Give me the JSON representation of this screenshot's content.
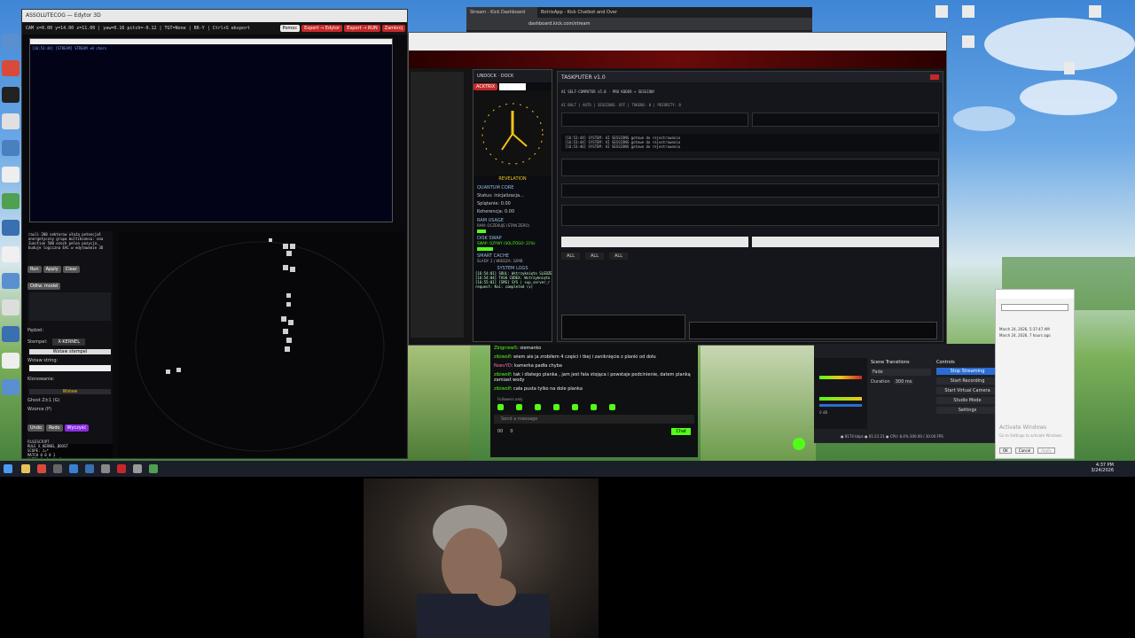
{
  "editor": {
    "title": "ASSOLUTECOG — Edytor 3D",
    "status_line": "CAM x=0.00 y=14.00 z=11.00 | yaw=0.16 pitch=-0.12 | TGT=None | BR-Y | Ctrl+S eksport",
    "buttons": [
      "Pomoc",
      "Export → Edytor",
      "Export → RUN",
      "Zamknij"
    ],
    "console_line": "[16:53:44] [STREAM] STREAM +0 chars",
    "left_text": "rauli 200 sektorow ułożą potencjał energetyczny grupa multiksonsu: ona Junction 500 ezoch pelna pozycja, buduje logiczna EAC w edytowanie 3D",
    "left_buttons": [
      "Run",
      "Apply",
      "Clear",
      "Odtw. model"
    ],
    "field_labels": [
      "Pędzel:",
      "Stempel:",
      "Wstaw string:",
      "Klonowanie:"
    ],
    "stamp_value": "X-KERNEL",
    "insert_stamp": "Wstaw stempel",
    "insert": "Wstaw",
    "checks": [
      "Ghost Z±1 (G)",
      "Wzorce (P)"
    ],
    "undo_buttons": [
      "Undo",
      "Redo",
      "Wyczyść"
    ],
    "rule_header": "RULESCRIPT",
    "rule_text": "RULE X_KERNEL_BOOST\nSCOPE: z=*\nMATCH 0 0 0 1\nMATCH 0 -1 -1 +1"
  },
  "browser": {
    "tabs": [
      "Stream - Kick Dashboard",
      "BotrixApp - Kick Chatbot and Overlay"
    ],
    "url": "dashboard.kick.com/stream"
  },
  "taskputer": {
    "dock_title": "UNDOCK · DOCK",
    "tab": "ACKTRIX",
    "clock_label": "REVELATION",
    "quantum": "QUANTUM CORE",
    "status_rows": [
      "Status: inicjalizacja...",
      "Splątanie: 0.00",
      "Koherencja: 0.00"
    ],
    "ram": "RAM USAGE",
    "ram_status": "RAM: OCZEKUJE (STAN ZERO)",
    "disk": "DISK SWAP",
    "swap_status": "SWAP: OZYWY (SOLITOGO: 21%)",
    "cache": "SMART CACHE",
    "cache_status": "ŚLADY: 2 | WIEDZA: 32MB",
    "logs": "SYSTEM LOGS",
    "logs_text": "[16:54:01] SOUL: Wstrzyknięto SLEDZE\n[16:54:04] TASK CODEX: Wstrzyknięto\n[16:55:01] [SMS] SYS | sup_server_r\nrequest: Koi: completed (v)",
    "main_title": "TASKPUTER v1.0",
    "header_line": "AI SELF-COMPUTER v5.0 · PRO KODER + SESSION!",
    "sessions_line": "AI BALT | AUTO | SESSIONS: OFF | TOKENS: 0 | PRIORITY: 0",
    "filters": [
      "ALL",
      "ALL",
      "ALL"
    ],
    "log_lines": "[16:53:44] SYSTEM: AI SESSIONS gotowe do rejestrowania\n[16:53:44] SYSTEM: AI SESSIONS gotowe do rejestrowania\n[16:53:46] SYSTEM: AI SESSIONS gotowe do rejestrowania"
  },
  "chat": {
    "messages": [
      {
        "user": "Zbigniew5",
        "text": "siemanko"
      },
      {
        "user": "zibiwolf",
        "text": "wiem ale ja zrobiłem 4 części i tkej i zaniknięcie z planki od dołu"
      },
      {
        "user": "NoevYD",
        "text": "kamerka padła chyba"
      },
      {
        "user": "zibiwolf",
        "text": "tak i dlatego planka , jam jest fala stojąca i powstaje podcinienie, datem planką zamiast wody"
      },
      {
        "user": "zibiwolf",
        "text": "cała pusta tylko na dole planka"
      }
    ],
    "followers_only": "Followers only",
    "placeholder": "Send a message",
    "count_a": "00",
    "count_b": "0",
    "send": "Chat"
  },
  "obs": {
    "scene_transitions": "Scene Transitions",
    "fade": "Fade",
    "duration_label": "Duration",
    "duration": "300 ms",
    "controls": "Controls",
    "buttons": [
      "Stop Streaming",
      "Start Recording",
      "Start Virtual Camera",
      "Studio Mode",
      "Settings"
    ],
    "stats": "● 8174 kbps   ● 01:21:21   ● CPU: 8.4%   300.00 / 30.00 FPS",
    "meter_value": "0 dB"
  },
  "props": {
    "activate_title": "Activate Windows",
    "activate_sub": "Go to Settings to activate Windows.",
    "date_lines": [
      "March 24, 2026, 5:37:47 AM",
      "March 24, 2026, 7 hours ago"
    ],
    "buttons": [
      "OK",
      "Cancel",
      "Apply"
    ]
  },
  "tray": {
    "time": "4:37 PM",
    "date": "3/24/2026"
  },
  "colors": {
    "accent_green": "#53fc18",
    "taskputer_red": "#c62828",
    "obs_blue": "#2b6cd4",
    "clock_yellow": "#f2c418"
  }
}
